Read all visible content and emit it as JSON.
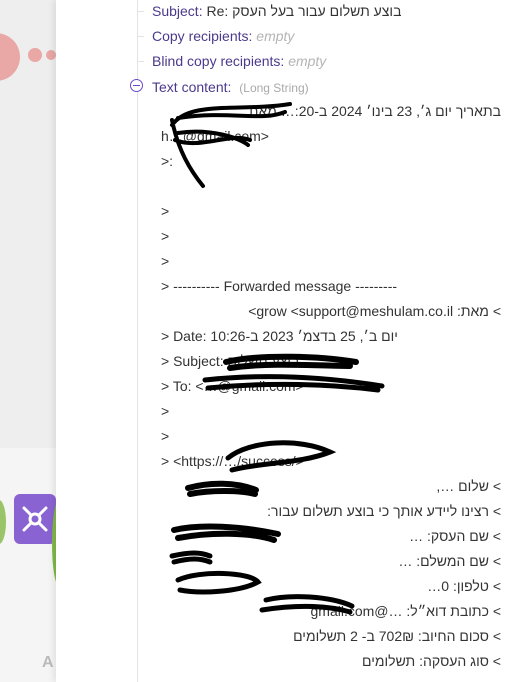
{
  "fields": {
    "subject_label": "Subject:",
    "subject_value": "Re: בוצע תשלום עבור בעל העסק",
    "copy_recipients_label": "Copy recipients:",
    "copy_recipients_value": "empty",
    "blind_copy_label": "Blind copy recipients:",
    "blind_copy_value": "empty",
    "text_content_label": "Text content:",
    "text_content_type": "(Long String)"
  },
  "content_lines": [
    {
      "text": "בתאריך יום ג׳, 23 בינו׳ 2024 ב-20:… מאת …",
      "dir": "rtl"
    },
    {
      "text": "h…@gmail.com>",
      "dir": "ltr"
    },
    {
      "text": ">:",
      "dir": "ltr"
    },
    {
      "text": "",
      "dir": "ltr"
    },
    {
      "text": ">",
      "dir": "ltr"
    },
    {
      "text": ">",
      "dir": "ltr"
    },
    {
      "text": ">",
      "dir": "ltr"
    },
    {
      "text": "> ---------- Forwarded message ---------",
      "dir": "ltr"
    },
    {
      "text": "> מאת: grow <support@meshulam.co.il>",
      "dir": "ltr"
    },
    {
      "text": "> Date: יום ב׳, 25 בדצמ׳ 2023 ב-10:26",
      "dir": "ltr"
    },
    {
      "text": "> Subject: בוצע תשלום …",
      "dir": "ltr"
    },
    {
      "text": "> To: <…@gmail.com>",
      "dir": "ltr"
    },
    {
      "text": ">",
      "dir": "ltr"
    },
    {
      "text": ">",
      "dir": "ltr"
    },
    {
      "text": "> <https://…/success/>",
      "dir": "ltr"
    },
    {
      "text": "> שלום …,",
      "dir": "ltr"
    },
    {
      "text": "> רצינו ליידע אותך כי בוצע תשלום עבור:",
      "dir": "ltr"
    },
    {
      "text": "> שם העסק: …",
      "dir": "ltr"
    },
    {
      "text": "> שם המשלם: …",
      "dir": "ltr"
    },
    {
      "text": "> טלפון: 0…",
      "dir": "ltr"
    },
    {
      "text": "> כתובת דוא״ל: …@gmail.com",
      "dir": "ltr"
    },
    {
      "text": "> סכום החיוב: 702₪ ב- 2 תשלומים",
      "dir": "ltr"
    },
    {
      "text": "> סוג העסקה: תשלומים",
      "dir": "ltr"
    }
  ],
  "background": {
    "faded_letter": "A"
  },
  "colors": {
    "label": "#4b3a8c",
    "accent_purple": "#6b47c8",
    "empty_text": "#b4b4b4",
    "redaction": "#000000"
  },
  "icons": [
    "collapse-minus-icon",
    "tools-icon"
  ]
}
